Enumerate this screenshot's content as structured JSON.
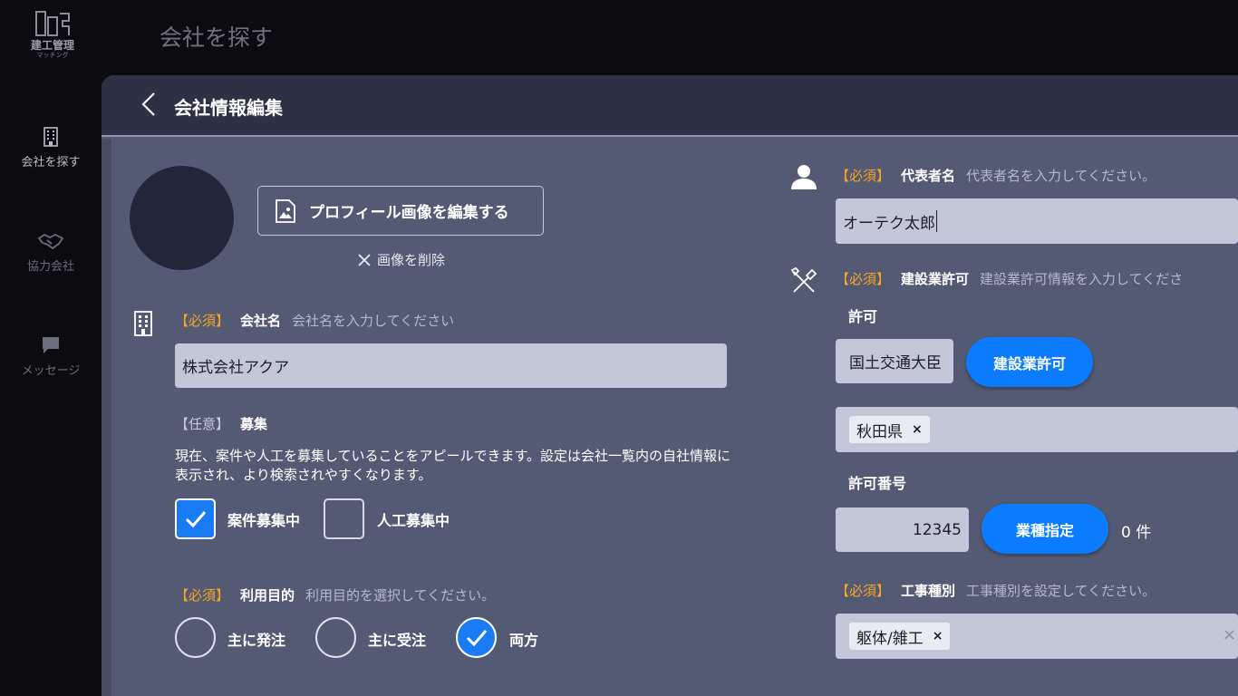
{
  "sidebar": {
    "logo_text": "建工管理",
    "logo_sub": "マッチング",
    "items": [
      {
        "label": "会社を探す",
        "icon": "building-icon"
      },
      {
        "label": "協力会社",
        "icon": "handshake-icon"
      },
      {
        "label": "メッセージ",
        "icon": "chat-icon"
      }
    ]
  },
  "header": {
    "title": "会社を探す"
  },
  "modal": {
    "title": "会社情報編集",
    "profile_button": "プロフィール画像を編集する",
    "delete_image": "画像を削除",
    "company": {
      "required": "【必須】",
      "label": "会社名",
      "hint": "会社名を入力してください",
      "value": "株式会社アクア"
    },
    "recruit": {
      "optional": "【任意】",
      "label": "募集",
      "description": "現在、案件や人工を募集していることをアピールできます。設定は会社一覧内の自社情報に表示され、より検索されやすくなります。",
      "options": [
        {
          "label": "案件募集中",
          "checked": true
        },
        {
          "label": "人工募集中",
          "checked": false
        }
      ]
    },
    "purpose": {
      "required": "【必須】",
      "label": "利用目的",
      "hint": "利用目的を選択してください。",
      "options": [
        {
          "label": "主に発注",
          "checked": false
        },
        {
          "label": "主に受注",
          "checked": false
        },
        {
          "label": "両方",
          "checked": true
        }
      ]
    },
    "representative": {
      "required": "【必須】",
      "label": "代表者名",
      "hint": "代表者名を入力してください。",
      "value": "オーテク太郎"
    },
    "license": {
      "required": "【必須】",
      "label": "建設業許可",
      "hint": "建設業許可情報を入力してくださ",
      "permit_label": "許可",
      "permit_value": "国土交通大臣",
      "permit_button": "建設業許可",
      "prefecture_chip": "秋田県",
      "number_label": "許可番号",
      "number_value": "12345",
      "industry_button": "業種指定",
      "count": "0 件"
    },
    "work_type": {
      "required": "【必須】",
      "label": "工事種別",
      "hint": "工事種別を設定してください。",
      "chip": "躯体/雑工"
    }
  },
  "colors": {
    "accent": "#0b7cff",
    "required": "#f5a623",
    "modal_bg": "#555a74",
    "header_bg": "#2e3046"
  }
}
